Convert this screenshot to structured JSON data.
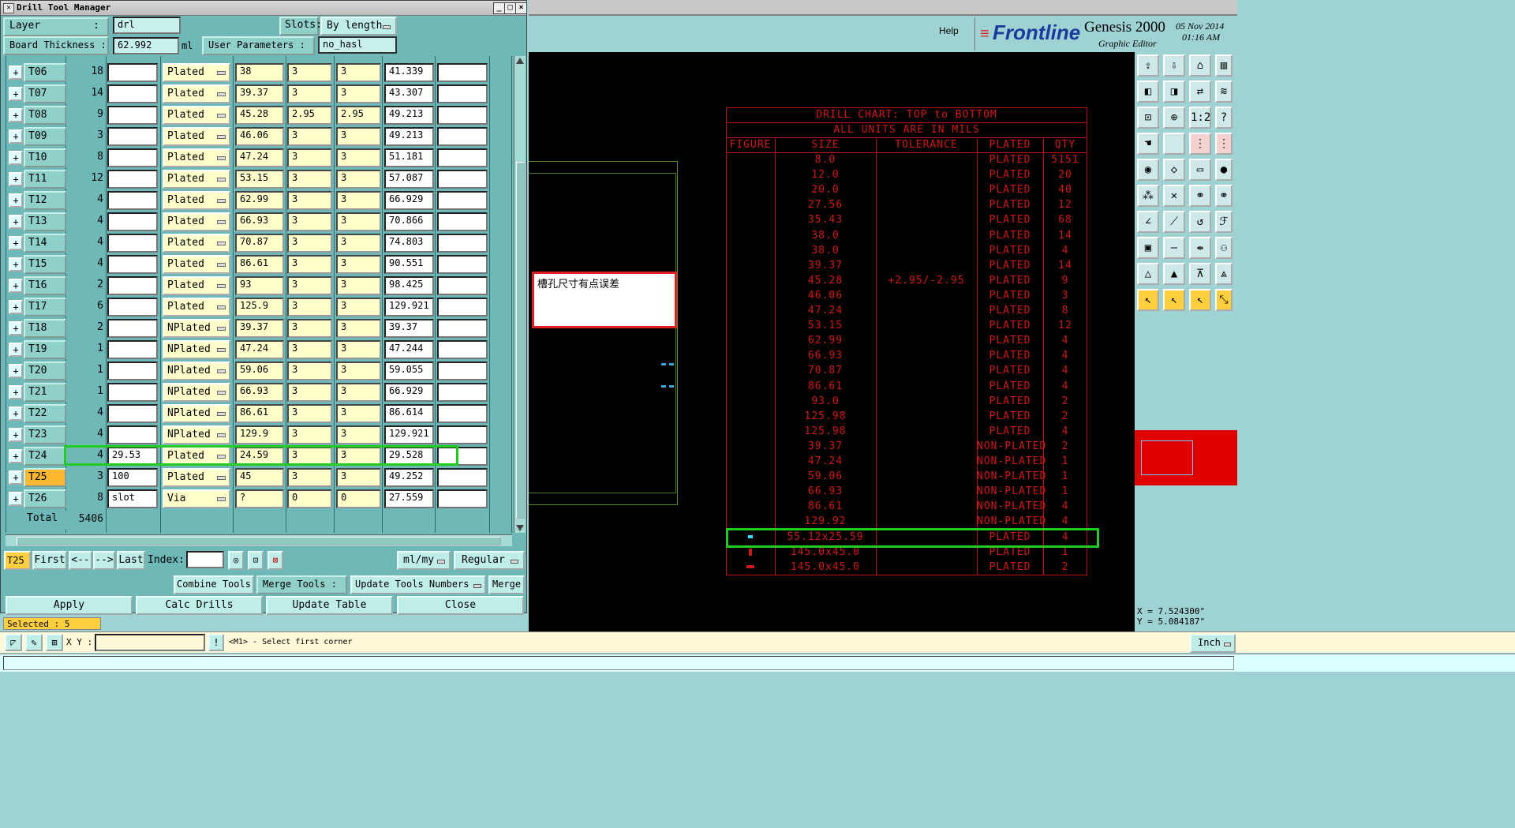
{
  "window": {
    "title": "Drill Tool Manager",
    "layer_label": "Layer",
    "layer_value": "drl",
    "slots_label": "Slots:",
    "slots_value": "By length",
    "board_thickness_label": "Board Thickness :",
    "board_thickness_value": "62.992",
    "board_thickness_unit": "ml",
    "user_params_label": "User Parameters :",
    "user_params_value": "no_hasl"
  },
  "tools": [
    {
      "name": "T06",
      "count": "18",
      "w": "",
      "type": "Plated",
      "size": "38",
      "tp": "3",
      "tm": "3",
      "fin": "41.339",
      "x": ""
    },
    {
      "name": "T07",
      "count": "14",
      "w": "",
      "type": "Plated",
      "size": "39.37",
      "tp": "3",
      "tm": "3",
      "fin": "43.307",
      "x": ""
    },
    {
      "name": "T08",
      "count": "9",
      "w": "",
      "type": "Plated",
      "size": "45.28",
      "tp": "2.95",
      "tm": "2.95",
      "fin": "49.213",
      "x": ""
    },
    {
      "name": "T09",
      "count": "3",
      "w": "",
      "type": "Plated",
      "size": "46.06",
      "tp": "3",
      "tm": "3",
      "fin": "49.213",
      "x": ""
    },
    {
      "name": "T10",
      "count": "8",
      "w": "",
      "type": "Plated",
      "size": "47.24",
      "tp": "3",
      "tm": "3",
      "fin": "51.181",
      "x": ""
    },
    {
      "name": "T11",
      "count": "12",
      "w": "",
      "type": "Plated",
      "size": "53.15",
      "tp": "3",
      "tm": "3",
      "fin": "57.087",
      "x": ""
    },
    {
      "name": "T12",
      "count": "4",
      "w": "",
      "type": "Plated",
      "size": "62.99",
      "tp": "3",
      "tm": "3",
      "fin": "66.929",
      "x": ""
    },
    {
      "name": "T13",
      "count": "4",
      "w": "",
      "type": "Plated",
      "size": "66.93",
      "tp": "3",
      "tm": "3",
      "fin": "70.866",
      "x": ""
    },
    {
      "name": "T14",
      "count": "4",
      "w": "",
      "type": "Plated",
      "size": "70.87",
      "tp": "3",
      "tm": "3",
      "fin": "74.803",
      "x": ""
    },
    {
      "name": "T15",
      "count": "4",
      "w": "",
      "type": "Plated",
      "size": "86.61",
      "tp": "3",
      "tm": "3",
      "fin": "90.551",
      "x": ""
    },
    {
      "name": "T16",
      "count": "2",
      "w": "",
      "type": "Plated",
      "size": "93",
      "tp": "3",
      "tm": "3",
      "fin": "98.425",
      "x": ""
    },
    {
      "name": "T17",
      "count": "6",
      "w": "",
      "type": "Plated",
      "size": "125.9",
      "tp": "3",
      "tm": "3",
      "fin": "129.921",
      "x": ""
    },
    {
      "name": "T18",
      "count": "2",
      "w": "",
      "type": "NPlated",
      "size": "39.37",
      "tp": "3",
      "tm": "3",
      "fin": "39.37",
      "x": ""
    },
    {
      "name": "T19",
      "count": "1",
      "w": "",
      "type": "NPlated",
      "size": "47.24",
      "tp": "3",
      "tm": "3",
      "fin": "47.244",
      "x": ""
    },
    {
      "name": "T20",
      "count": "1",
      "w": "",
      "type": "NPlated",
      "size": "59.06",
      "tp": "3",
      "tm": "3",
      "fin": "59.055",
      "x": ""
    },
    {
      "name": "T21",
      "count": "1",
      "w": "",
      "type": "NPlated",
      "size": "66.93",
      "tp": "3",
      "tm": "3",
      "fin": "66.929",
      "x": ""
    },
    {
      "name": "T22",
      "count": "4",
      "w": "",
      "type": "NPlated",
      "size": "86.61",
      "tp": "3",
      "tm": "3",
      "fin": "86.614",
      "x": ""
    },
    {
      "name": "T23",
      "count": "4",
      "w": "",
      "type": "NPlated",
      "size": "129.9",
      "tp": "3",
      "tm": "3",
      "fin": "129.921",
      "x": ""
    },
    {
      "name": "T24",
      "count": "4",
      "w": "29.53",
      "type": "Plated",
      "size": "24.59",
      "tp": "3",
      "tm": "3",
      "fin": "29.528",
      "x": ""
    },
    {
      "name": "T25",
      "count": "3",
      "w": "100",
      "type": "Plated",
      "size": "45",
      "tp": "3",
      "tm": "3",
      "fin": "49.252",
      "x": ""
    },
    {
      "name": "T26",
      "count": "8",
      "w": "slot",
      "type": "Via",
      "size": "?",
      "tp": "0",
      "tm": "0",
      "fin": "27.559",
      "x": ""
    }
  ],
  "total": {
    "label": "Total",
    "value": "5406"
  },
  "nav": {
    "current": "T25",
    "first": "First",
    "prev": "<--",
    "next": "-->",
    "last": "Last",
    "index_label": "Index:",
    "unit": "ml/my",
    "mode": "Regular"
  },
  "actions": {
    "combine": "Combine Tools",
    "merge_label": "Merge Tools :",
    "update_numbers": "Update Tools Numbers",
    "merge": "Merge",
    "apply": "Apply",
    "calc": "Calc Drills",
    "update_table": "Update Table",
    "close": "Close"
  },
  "status": {
    "selected": "Selected : 5",
    "xy_label": "X Y :",
    "hint": "<M1> - Select first corner",
    "unit": "Inch",
    "x_readout": "X = 7.524300\"",
    "y_readout": "Y = 5.084187\""
  },
  "header": {
    "help": "Help",
    "logo": "Frontline",
    "product": "Genesis 2000",
    "subtitle": "Graphic Editor",
    "date": "05 Nov 2014",
    "time": "01:16 AM"
  },
  "note": "槽孔尺寸有点误差",
  "drill_chart": {
    "title": "DRILL CHART: TOP to BOTTOM",
    "subtitle": "ALL UNITS ARE IN MILS",
    "headers": [
      "FIGURE",
      "SIZE",
      "TOLERANCE",
      "PLATED",
      "QTY"
    ],
    "rows": [
      {
        "size": "8.0",
        "tol": "",
        "plated": "PLATED",
        "qty": "5151"
      },
      {
        "size": "12.0",
        "tol": "",
        "plated": "PLATED",
        "qty": "20"
      },
      {
        "size": "20.0",
        "tol": "",
        "plated": "PLATED",
        "qty": "40"
      },
      {
        "size": "27.56",
        "tol": "",
        "plated": "PLATED",
        "qty": "12"
      },
      {
        "size": "35.43",
        "tol": "",
        "plated": "PLATED",
        "qty": "68"
      },
      {
        "size": "38.0",
        "tol": "",
        "plated": "PLATED",
        "qty": "14"
      },
      {
        "size": "38.0",
        "tol": "",
        "plated": "PLATED",
        "qty": "4"
      },
      {
        "size": "39.37",
        "tol": "",
        "plated": "PLATED",
        "qty": "14"
      },
      {
        "size": "45.28",
        "tol": "+2.95/-2.95",
        "plated": "PLATED",
        "qty": "9"
      },
      {
        "size": "46.06",
        "tol": "",
        "plated": "PLATED",
        "qty": "3"
      },
      {
        "size": "47.24",
        "tol": "",
        "plated": "PLATED",
        "qty": "8"
      },
      {
        "size": "53.15",
        "tol": "",
        "plated": "PLATED",
        "qty": "12"
      },
      {
        "size": "62.99",
        "tol": "",
        "plated": "PLATED",
        "qty": "4"
      },
      {
        "size": "66.93",
        "tol": "",
        "plated": "PLATED",
        "qty": "4"
      },
      {
        "size": "70.87",
        "tol": "",
        "plated": "PLATED",
        "qty": "4"
      },
      {
        "size": "86.61",
        "tol": "",
        "plated": "PLATED",
        "qty": "4"
      },
      {
        "size": "93.0",
        "tol": "",
        "plated": "PLATED",
        "qty": "2"
      },
      {
        "size": "125.98",
        "tol": "",
        "plated": "PLATED",
        "qty": "2"
      },
      {
        "size": "125.98",
        "tol": "",
        "plated": "PLATED",
        "qty": "4"
      },
      {
        "size": "39.37",
        "tol": "",
        "plated": "NON-PLATED",
        "qty": "2"
      },
      {
        "size": "47.24",
        "tol": "",
        "plated": "NON-PLATED",
        "qty": "1"
      },
      {
        "size": "59.06",
        "tol": "",
        "plated": "NON-PLATED",
        "qty": "1"
      },
      {
        "size": "66.93",
        "tol": "",
        "plated": "NON-PLATED",
        "qty": "1"
      },
      {
        "size": "86.61",
        "tol": "",
        "plated": "NON-PLATED",
        "qty": "4"
      },
      {
        "size": "129.92",
        "tol": "",
        "plated": "NON-PLATED",
        "qty": "4"
      },
      {
        "size": "55.12x25.59",
        "tol": "",
        "plated": "PLATED",
        "qty": "4"
      },
      {
        "size": "145.0x45.0",
        "tol": "",
        "plated": "PLATED",
        "qty": "1"
      },
      {
        "size": "145.0x45.0",
        "tol": "",
        "plated": "PLATED",
        "qty": "2"
      }
    ]
  },
  "colors": {
    "chart_red": "#d01818",
    "highlight_green": "#22cc22",
    "tool_selected": "#ffb830",
    "panel_cyan": "#9fd3d3"
  }
}
